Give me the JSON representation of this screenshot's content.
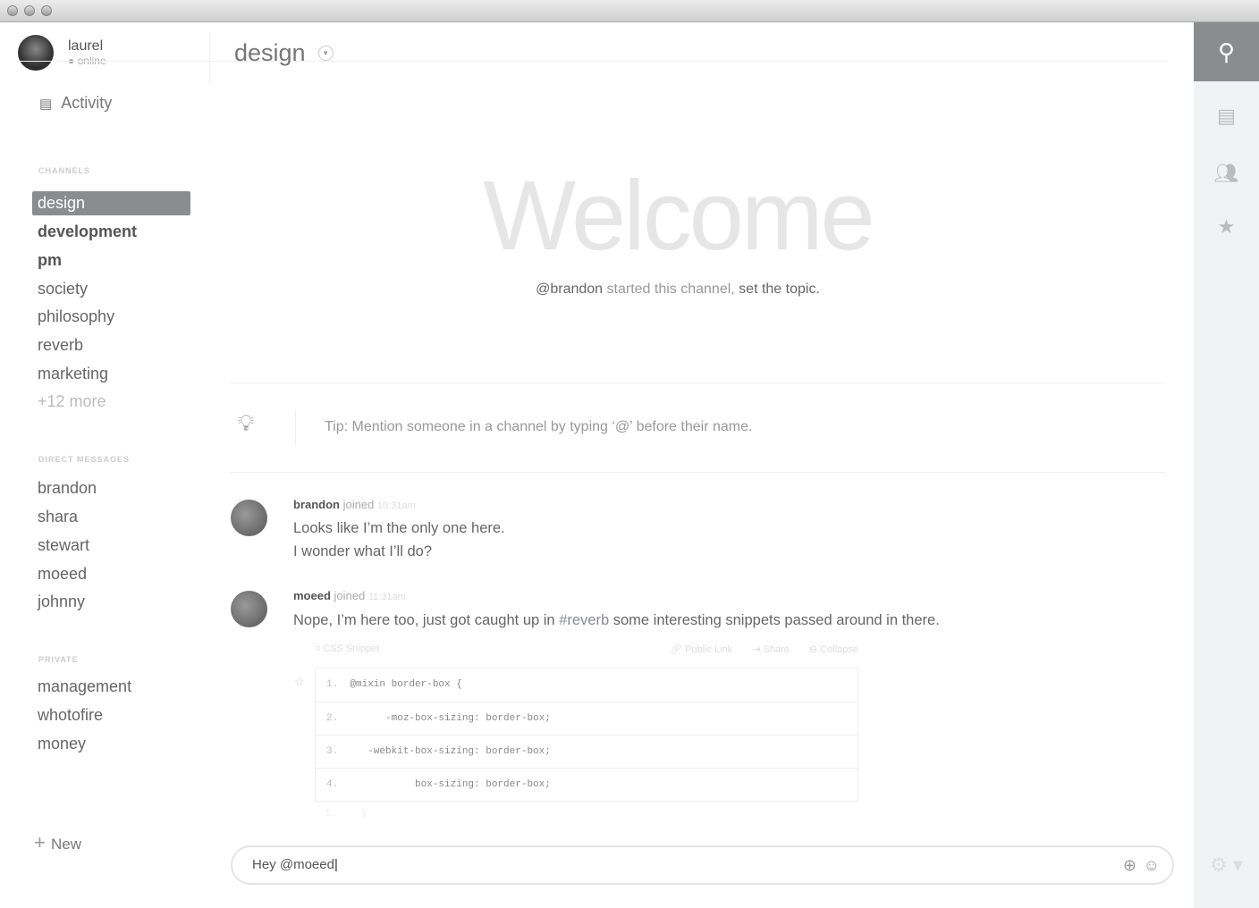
{
  "user": {
    "name": "laurel",
    "status": "online"
  },
  "sidebar": {
    "activity": "Activity",
    "channels_header": "CHANNELS",
    "channels": [
      "design",
      "development",
      "pm",
      "society",
      "philosophy",
      "reverb",
      "marketing"
    ],
    "channels_more": "+12 more",
    "dm_header": "DIRECT MESSAGES",
    "dms": [
      "brandon",
      "shara",
      "stewart",
      "moeed",
      "johnny"
    ],
    "private_header": "PRIVATE",
    "private": [
      "management",
      "whotofire",
      "money"
    ],
    "new_label": "New"
  },
  "channel": {
    "name": "design",
    "welcome": "Welcome",
    "started_user": "@brandon",
    "started_text": " started this channel, ",
    "set_topic": "set the topic."
  },
  "tip": "Tip: Mention someone in a channel by typing ‘@’ before their name.",
  "messages": [
    {
      "user": "brandon",
      "action": " joined ",
      "time": "10:31am",
      "lines": [
        "Looks like I’m the only one here.",
        "I wonder what I’ll do?"
      ]
    },
    {
      "user": "moeed",
      "action": " joined ",
      "time": "11:31am",
      "pre": "Nope, I’m here too, just got caught up in ",
      "channel": "#reverb",
      "post": " some interesting snippets passed around in there."
    }
  ],
  "snippet": {
    "title": "CSS Snippet",
    "public_link": "Public Link",
    "share": "Share",
    "collapse": "Collapse",
    "lines": [
      {
        "n": "1.",
        "code": "  @mixin border-box {"
      },
      {
        "n": "2.",
        "code": "        -moz-box-sizing: border-box;"
      },
      {
        "n": "3.",
        "code": "     -webkit-box-sizing: border-box;"
      },
      {
        "n": "4.",
        "code": "             box-sizing: border-box;"
      }
    ],
    "last": {
      "n": "5.",
      "code": "    }"
    }
  },
  "composer": {
    "value": "Hey @moeed"
  },
  "rail": {
    "icons": [
      "search-icon",
      "inbox-icon",
      "people-icon",
      "star-icon"
    ],
    "active": "search-icon"
  },
  "colors": {
    "selected": "#8a8c90",
    "rail": "#f1f2f3"
  }
}
